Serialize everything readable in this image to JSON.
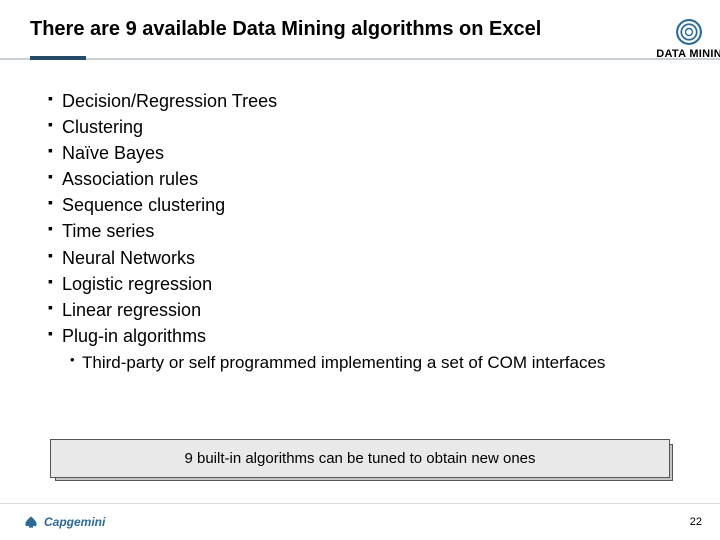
{
  "header": {
    "title": "There are 9 available Data Mining algorithms on Excel",
    "badge_label": "DATA MININ"
  },
  "bullets": [
    "Decision/Regression Trees",
    "Clustering",
    "Naïve Bayes",
    "Association rules",
    "Sequence clustering",
    "Time series",
    "Neural Networks",
    "Logistic regression",
    "Linear regression",
    "Plug-in algorithms"
  ],
  "sub_bullets": [
    "Third-party or self programmed implementing a set of COM interfaces"
  ],
  "callout": "9 built-in algorithms can be tuned to obtain new ones",
  "footer": {
    "logo_text": "Capgemini",
    "page_number": "22"
  }
}
